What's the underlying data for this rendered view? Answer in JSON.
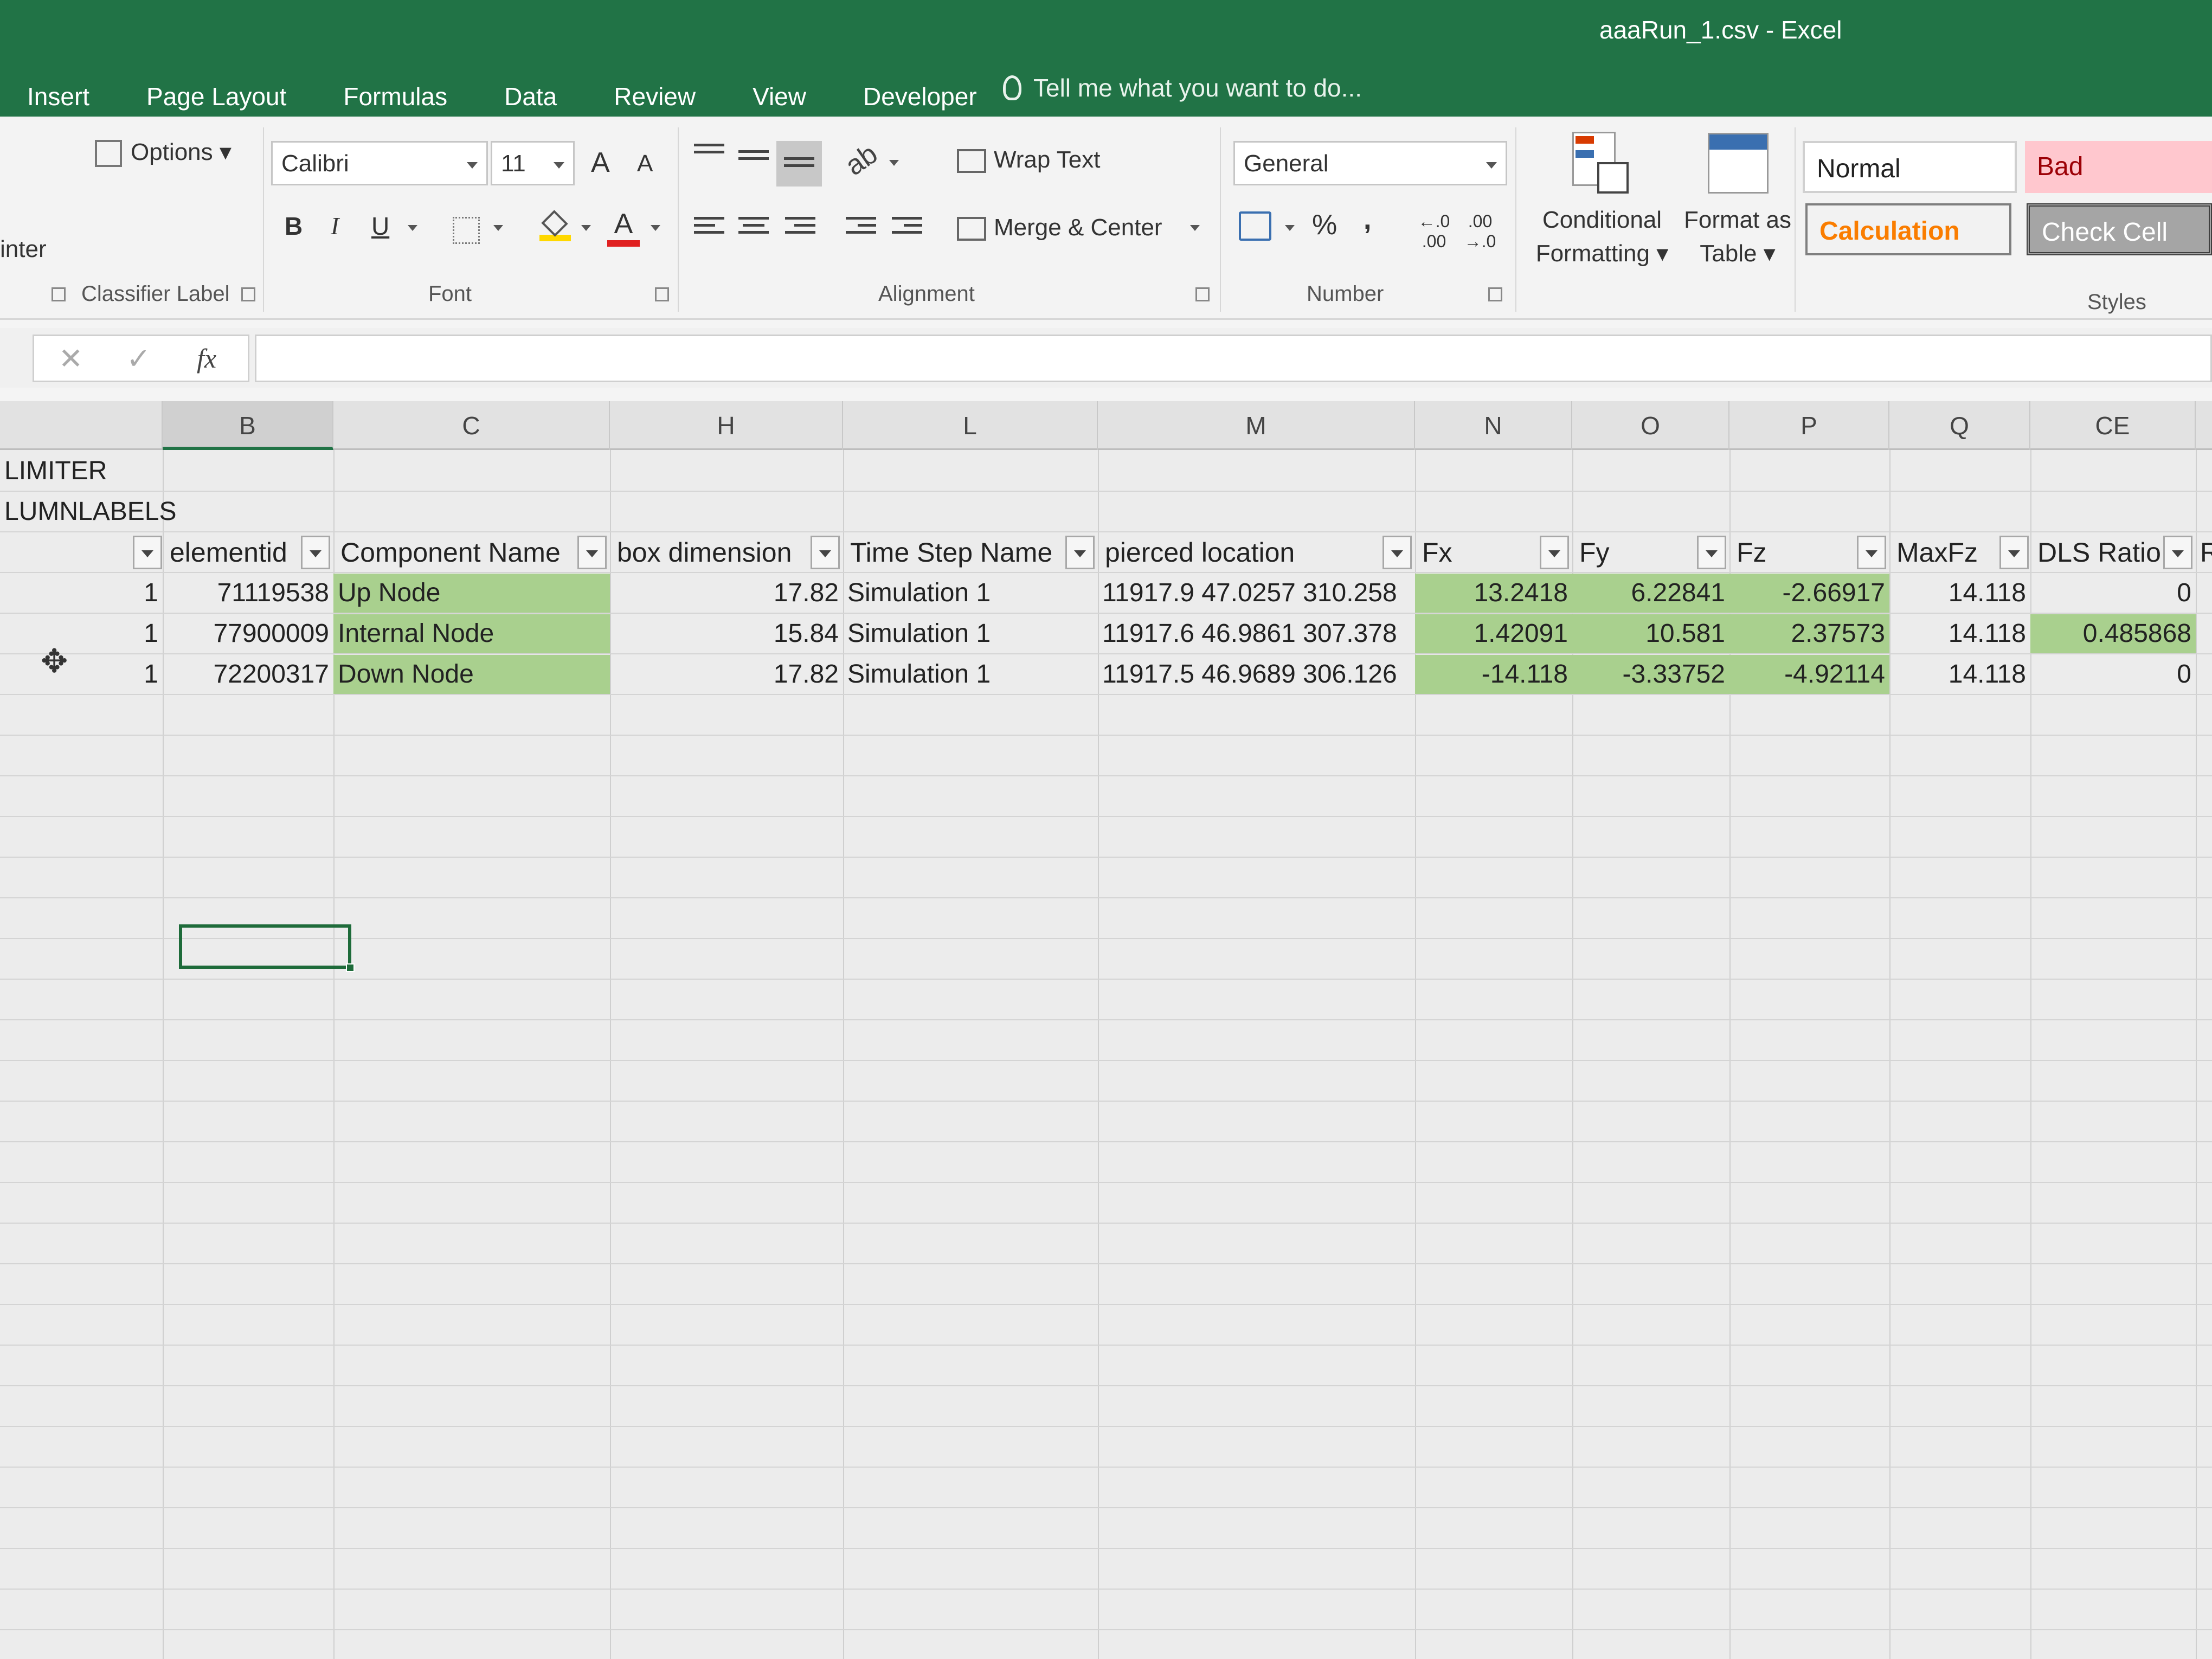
{
  "window": {
    "title": "aaaRun_1.csv - Excel"
  },
  "menu_tabs": [
    "Insert",
    "Page Layout",
    "Formulas",
    "Data",
    "Review",
    "View",
    "Developer"
  ],
  "tell_me": "Tell me what you want to do...",
  "ribbon": {
    "options_label": "Options",
    "painter_label": "inter",
    "classifier_label": "Classifier Label",
    "font": {
      "name": "Calibri",
      "size": "11",
      "bold": "B",
      "italic": "I",
      "underline": "U",
      "grow": "A",
      "shrink": "A",
      "color_a": "A",
      "group": "Font"
    },
    "alignment": {
      "wrap_text": "Wrap Text",
      "merge_center": "Merge & Center",
      "group": "Alignment"
    },
    "number": {
      "format": "General",
      "percent": "%",
      "comma": ",",
      "inc_decimal": "←.0 .00",
      "dec_decimal": ".00 →.0",
      "group": "Number"
    },
    "styles": {
      "conditional_formatting": [
        "Conditional",
        "Formatting"
      ],
      "format_as_table": [
        "Format as",
        "Table"
      ],
      "normal": "Normal",
      "bad": "Bad",
      "calculation": "Calculation",
      "check_cell": "Check Cell",
      "group": "Styles"
    }
  },
  "formula_bar": {
    "cancel": "✕",
    "enter": "✓",
    "fx": "fx",
    "value": ""
  },
  "columns": [
    "B",
    "C",
    "H",
    "L",
    "M",
    "N",
    "O",
    "P",
    "Q",
    "CE"
  ],
  "sheet": {
    "row_labels": [
      "LIMITER",
      "LUMNLABELS"
    ],
    "headers": [
      "elementid",
      "Component Name",
      "box dimension",
      "Time Step Name",
      "pierced location",
      "Fx",
      "Fy",
      "Fz",
      "MaxFz",
      "DLS Ratio",
      "R"
    ],
    "rows": [
      {
        "a": "1",
        "elementid": "71119538",
        "component": "Up Node",
        "box": "17.82",
        "timestep": "Simulation 1",
        "location": "11917.9 47.0257 310.258",
        "fx": "13.2418",
        "fy": "6.22841",
        "fz": "-2.66917",
        "maxfz": "14.118",
        "dls": "0"
      },
      {
        "a": "1",
        "elementid": "77900009",
        "component": "Internal Node",
        "box": "15.84",
        "timestep": "Simulation 1",
        "location": "11917.6 46.9861 307.378",
        "fx": "1.42091",
        "fy": "10.581",
        "fz": "2.37573",
        "maxfz": "14.118",
        "dls": "0.485868"
      },
      {
        "a": "1",
        "elementid": "72200317",
        "component": "Down Node",
        "box": "17.82",
        "timestep": "Simulation 1",
        "location": "11917.5 46.9689 306.126",
        "fx": "-14.118",
        "fy": "-3.33752",
        "fz": "-4.92114",
        "maxfz": "14.118",
        "dls": "0"
      }
    ]
  },
  "colors": {
    "accent": "#217346",
    "highlight": "#a9d08e",
    "bad_bg": "#ffc7ce",
    "bad_text": "#9c0006",
    "calc_text": "#fa7d00",
    "check_bg": "#a5a5a5"
  }
}
